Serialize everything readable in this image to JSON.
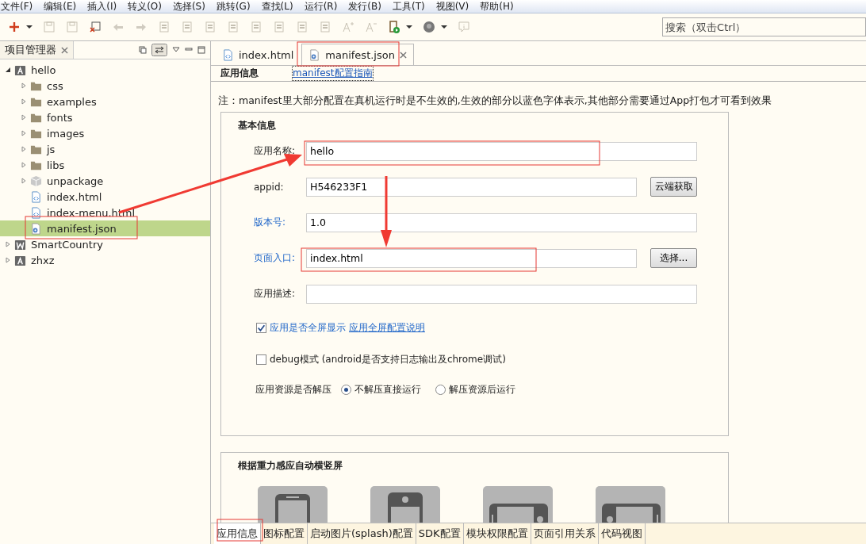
{
  "menu": [
    "文件(F)",
    "编辑(E)",
    "插入(I)",
    "转义(O)",
    "选择(S)",
    "跳转(G)",
    "查找(L)",
    "运行(R)",
    "发行(B)",
    "工具(T)",
    "视图(V)",
    "帮助(H)"
  ],
  "search": {
    "placeholder": "搜索（双击Ctrl）"
  },
  "project_panel": {
    "title": "项目管理器",
    "tree": [
      {
        "label": "hello",
        "kind": "project-a",
        "expanded": true,
        "selected": false,
        "children": [
          {
            "label": "css",
            "kind": "folder",
            "expanded": false,
            "selected": false
          },
          {
            "label": "examples",
            "kind": "folder",
            "expanded": false,
            "selected": false
          },
          {
            "label": "fonts",
            "kind": "folder",
            "expanded": false,
            "selected": false
          },
          {
            "label": "images",
            "kind": "folder",
            "expanded": false,
            "selected": false
          },
          {
            "label": "js",
            "kind": "folder",
            "expanded": false,
            "selected": false
          },
          {
            "label": "libs",
            "kind": "folder",
            "expanded": false,
            "selected": false
          },
          {
            "label": "unpackage",
            "kind": "package",
            "expanded": false,
            "selected": false
          },
          {
            "label": "index.html",
            "kind": "html",
            "selected": false
          },
          {
            "label": "index-menu.html",
            "kind": "html",
            "selected": false
          },
          {
            "label": "manifest.json",
            "kind": "json",
            "selected": true
          }
        ]
      },
      {
        "label": "SmartCountry",
        "kind": "project-w",
        "expanded": false,
        "selected": false
      },
      {
        "label": "zhxz",
        "kind": "project-a",
        "expanded": false,
        "selected": false
      }
    ]
  },
  "editor_tabs": [
    {
      "label": "index.html",
      "kind": "html",
      "selected": false
    },
    {
      "label": "manifest.json",
      "kind": "json",
      "selected": true
    }
  ],
  "page_header": {
    "title": "应用信息",
    "link": "manifest配置指南"
  },
  "note": "注：manifest里大部分配置在真机运行时是不生效的,生效的部分以蓝色字体表示,其他部分需要通过App打包才可看到效果",
  "basic_info": {
    "title": "基本信息",
    "fields": [
      {
        "label": "应用名称:",
        "value": "hello",
        "effective": false
      },
      {
        "label": "appid:",
        "value": "H546233F1",
        "effective": false,
        "button": "云端获取"
      },
      {
        "label": "版本号:",
        "value": "1.0",
        "effective": true
      },
      {
        "label": "页面入口:",
        "value": "index.html",
        "effective": true,
        "button": "选择..."
      },
      {
        "label": "应用描述:",
        "effective": false
      }
    ],
    "checkboxes": [
      {
        "label": "应用是否全屏显示",
        "link": "应用全屏配置说明",
        "checked": true,
        "effective": true
      },
      {
        "label": "debug模式 (android是否支持日志输出及chrome调试)",
        "checked": false,
        "effective": false
      }
    ],
    "unpack": {
      "label": "应用资源是否解压",
      "options": [
        {
          "label": "不解压直接运行",
          "selected": true
        },
        {
          "label": "解压资源后运行",
          "selected": false
        }
      ]
    }
  },
  "orientation": {
    "title": "根据重力感应自动横竖屏",
    "options": [
      {
        "kind": "portrait"
      },
      {
        "kind": "portrait-camera"
      },
      {
        "kind": "landscape-right"
      },
      {
        "kind": "landscape-left"
      }
    ]
  },
  "bottom_tabs": [
    {
      "label": "应用信息",
      "selected": true
    },
    {
      "label": "图标配置",
      "selected": false
    },
    {
      "label": "启动图片(splash)配置",
      "selected": false
    },
    {
      "label": "SDK配置",
      "selected": false
    },
    {
      "label": "模块权限配置",
      "selected": false
    },
    {
      "label": "页面引用关系",
      "selected": false
    },
    {
      "label": "代码视图",
      "selected": false
    }
  ]
}
